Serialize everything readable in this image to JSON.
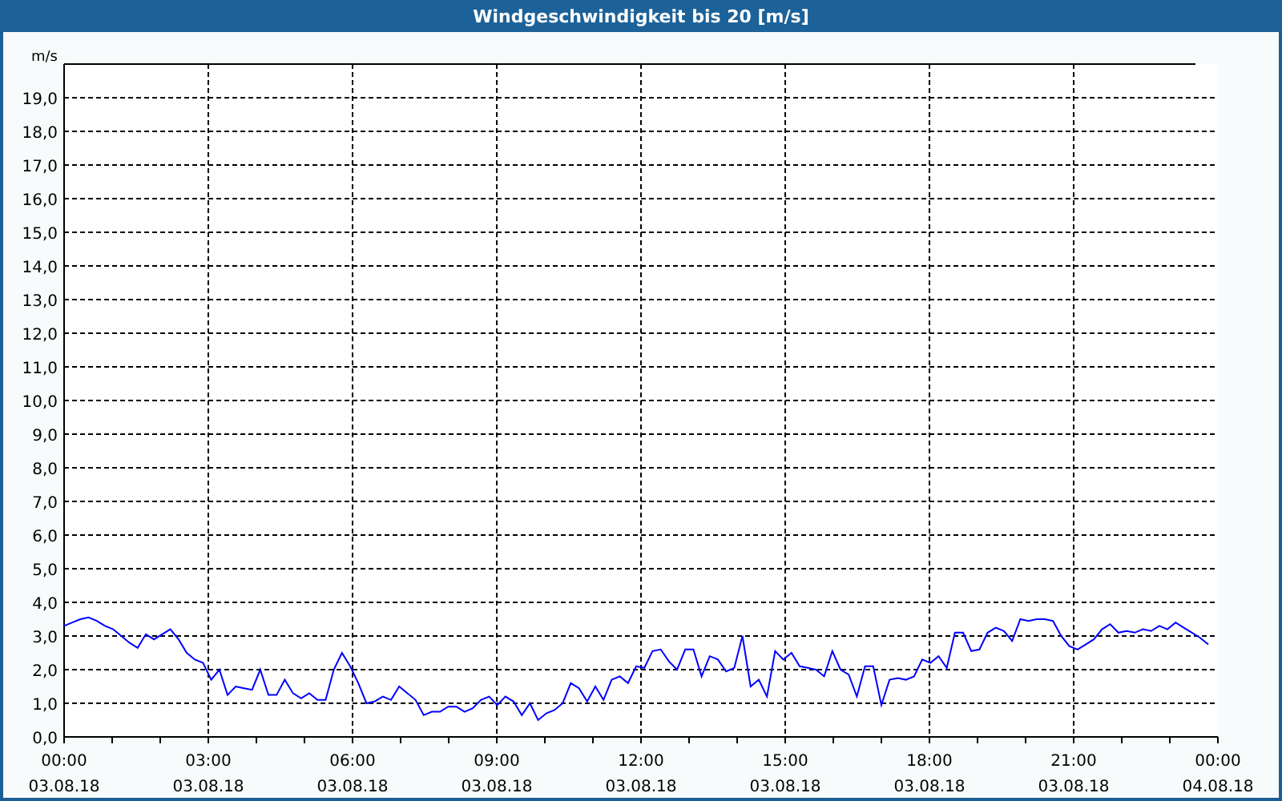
{
  "window": {
    "title": "Windgeschwindigkeit bis 20 [m/s]"
  },
  "chart": {
    "chart_data": {
      "type": "line",
      "ylabel": "m/s",
      "xlim": [
        0,
        24
      ],
      "ylim": [
        0,
        20
      ],
      "grid": true,
      "yticks": [
        {
          "value": 0,
          "label": "0,0"
        },
        {
          "value": 1,
          "label": "1,0"
        },
        {
          "value": 2,
          "label": "2,0"
        },
        {
          "value": 3,
          "label": "3,0"
        },
        {
          "value": 4,
          "label": "4,0"
        },
        {
          "value": 5,
          "label": "5,0"
        },
        {
          "value": 6,
          "label": "6,0"
        },
        {
          "value": 7,
          "label": "7,0"
        },
        {
          "value": 8,
          "label": "8,0"
        },
        {
          "value": 9,
          "label": "9,0"
        },
        {
          "value": 10,
          "label": "10,0"
        },
        {
          "value": 11,
          "label": "11,0"
        },
        {
          "value": 12,
          "label": "12,0"
        },
        {
          "value": 13,
          "label": "13,0"
        },
        {
          "value": 14,
          "label": "14,0"
        },
        {
          "value": 15,
          "label": "15,0"
        },
        {
          "value": 16,
          "label": "16,0"
        },
        {
          "value": 17,
          "label": "17,0"
        },
        {
          "value": 18,
          "label": "18,0"
        },
        {
          "value": 19,
          "label": "19,0"
        }
      ],
      "xticks": [
        {
          "value": 0,
          "label": "00:00"
        },
        {
          "value": 3,
          "label": "03:00"
        },
        {
          "value": 6,
          "label": "06:00"
        },
        {
          "value": 9,
          "label": "09:00"
        },
        {
          "value": 12,
          "label": "12:00"
        },
        {
          "value": 15,
          "label": "15:00"
        },
        {
          "value": 18,
          "label": "18:00"
        },
        {
          "value": 21,
          "label": "21:00"
        },
        {
          "value": 24,
          "label": "00:00"
        }
      ],
      "x": [
        0,
        0.17,
        0.34,
        0.51,
        0.68,
        0.85,
        1.02,
        1.19,
        1.36,
        1.53,
        1.7,
        1.87,
        2.04,
        2.21,
        2.38,
        2.55,
        2.72,
        2.89,
        3.06,
        3.23,
        3.4,
        3.57,
        3.74,
        3.91,
        4.08,
        4.25,
        4.42,
        4.59,
        4.76,
        4.93,
        5.1,
        5.27,
        5.44,
        5.61,
        5.78,
        5.95,
        6.12,
        6.29,
        6.46,
        6.63,
        6.8,
        6.97,
        7.14,
        7.31,
        7.48,
        7.65,
        7.82,
        7.99,
        8.16,
        8.33,
        8.5,
        8.67,
        8.84,
        9.01,
        9.18,
        9.35,
        9.52,
        9.69,
        9.86,
        10.03,
        10.2,
        10.37,
        10.54,
        10.71,
        10.88,
        11.05,
        11.22,
        11.39,
        11.56,
        11.73,
        11.9,
        12.07,
        12.24,
        12.41,
        12.58,
        12.75,
        12.92,
        13.09,
        13.26,
        13.43,
        13.6,
        13.77,
        13.94,
        14.11,
        14.28,
        14.45,
        14.62,
        14.79,
        14.96,
        15.13,
        15.3,
        15.47,
        15.64,
        15.81,
        15.98,
        16.15,
        16.32,
        16.49,
        16.66,
        16.83,
        17,
        17.17,
        17.34,
        17.51,
        17.68,
        17.85,
        18.02,
        18.19,
        18.36,
        18.53,
        18.7,
        18.87,
        19.04,
        19.21,
        19.38,
        19.55,
        19.72,
        19.89,
        20.06,
        20.23,
        20.4,
        20.57,
        20.74,
        20.91,
        21.08,
        21.25,
        21.42,
        21.59,
        21.76,
        21.93,
        22.1,
        22.27,
        22.44,
        22.61,
        22.78,
        22.95,
        23.12,
        23.29,
        23.46,
        23.63,
        23.8
      ],
      "series": [
        {
          "color": "#0000ff",
          "values": [
            3.3,
            3.4,
            3.5,
            3.55,
            3.45,
            3.3,
            3.2,
            3.0,
            2.8,
            2.65,
            3.05,
            2.9,
            3.05,
            3.2,
            2.9,
            2.5,
            2.3,
            2.2,
            1.7,
            2.0,
            1.25,
            1.5,
            1.45,
            1.4,
            2.0,
            1.25,
            1.25,
            1.7,
            1.3,
            1.15,
            1.3,
            1.1,
            1.1,
            2.0,
            2.5,
            2.1,
            1.6,
            1.0,
            1.05,
            1.2,
            1.1,
            1.5,
            1.3,
            1.1,
            0.65,
            0.75,
            0.75,
            0.9,
            0.9,
            0.75,
            0.85,
            1.1,
            1.2,
            0.95,
            1.2,
            1.05,
            0.65,
            1.0,
            0.5,
            0.7,
            0.8,
            1.0,
            1.6,
            1.45,
            1.05,
            1.5,
            1.1,
            1.7,
            1.8,
            1.6,
            2.1,
            2.05,
            2.55,
            2.6,
            2.25,
            2.0,
            2.6,
            2.6,
            1.8,
            2.4,
            2.3,
            1.95,
            2.05,
            3.0,
            1.5,
            1.7,
            1.2,
            2.55,
            2.3,
            2.5,
            2.1,
            2.05,
            2.0,
            1.8,
            2.55,
            2.0,
            1.85,
            1.2,
            2.1,
            2.1,
            0.95,
            1.7,
            1.75,
            1.7,
            1.8,
            2.3,
            2.2,
            2.4,
            2.05,
            3.1,
            3.1,
            2.55,
            2.6,
            3.1,
            3.25,
            3.15,
            2.85,
            3.5,
            3.45,
            3.5,
            3.5,
            3.45,
            3.0,
            2.7,
            2.6,
            2.75,
            2.9,
            3.2,
            3.35,
            3.1,
            3.15,
            3.1,
            3.2,
            3.15,
            3.3,
            3.2,
            3.4,
            3.25,
            3.1,
            2.95,
            2.75
          ]
        }
      ]
    },
    "xtick_dates": [
      "03.08.18",
      "03.08.18",
      "03.08.18",
      "03.08.18",
      "03.08.18",
      "03.08.18",
      "03.08.18",
      "03.08.18",
      "04.08.18"
    ]
  }
}
